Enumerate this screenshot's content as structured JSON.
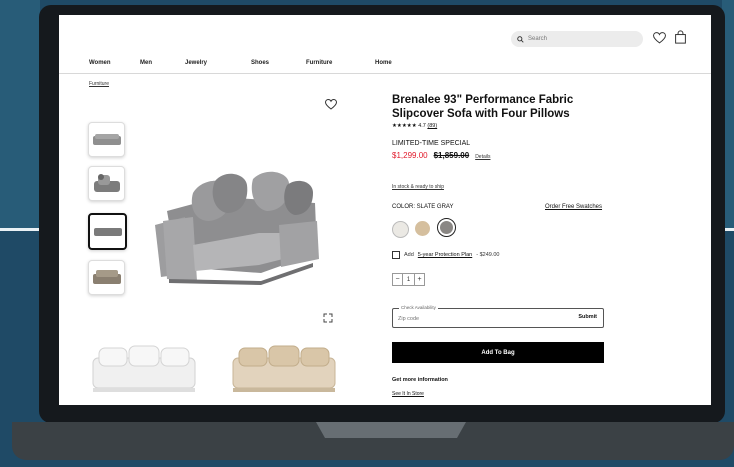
{
  "header": {
    "search_placeholder": "Search",
    "nav": [
      "Women",
      "Men",
      "Jewelry",
      "Shoes",
      "Furniture",
      "Home"
    ]
  },
  "breadcrumb": "Furniture",
  "product": {
    "title": "Brenalee 93\" Performance Fabric Slipcover Sofa with Four Pillows",
    "stars": "★★★★★",
    "rating": "4.7",
    "review_count": "(89)",
    "promo": "LIMITED-TIME SPECIAL",
    "sale_price": "$1,299.00",
    "original_price": "$1,859.00",
    "details_link": "Details",
    "stock": "In stock & ready to ship",
    "color_label": "COLOR:  SLATE GRAY",
    "swatch_link": "Order Free Swatches",
    "swatches": [
      "#ebe9e4",
      "#d5bf9e",
      "#8a8784"
    ],
    "protection_prefix": "Add",
    "protection_link": "5-year Protection Plan",
    "protection_price": "- $249.00",
    "quantity": "1",
    "qty_minus": "−",
    "qty_plus": "+",
    "check_availability": "Check Availability",
    "zip_placeholder": "Zip code",
    "submit": "Submit",
    "add_to_bag": "Add To Bag",
    "more_info": "Get more information",
    "store_link": "See It In Store"
  },
  "colors": {
    "sale": "#e11a2b",
    "button": "#000000"
  },
  "icons": [
    "search-icon",
    "heart-icon",
    "bag-icon",
    "favorite-icon",
    "expand-icon"
  ]
}
